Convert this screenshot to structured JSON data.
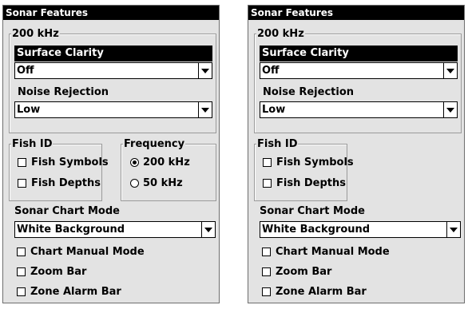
{
  "left": {
    "title": "Sonar Features",
    "group_200khz": "200 kHz",
    "surface_clarity_label": "Surface Clarity",
    "surface_clarity_value": "Off",
    "noise_rejection_label": "Noise Rejection",
    "noise_rejection_value": "Low",
    "fish_id_label": "Fish ID",
    "fish_symbols": "Fish Symbols",
    "fish_depths": "Fish Depths",
    "frequency_label": "Frequency",
    "freq_200": "200 kHz",
    "freq_50": "50 kHz",
    "chart_mode_label": "Sonar Chart Mode",
    "chart_mode_value": "White Background",
    "chart_manual_mode": "Chart Manual Mode",
    "zoom_bar": "Zoom Bar",
    "zone_alarm_bar": "Zone Alarm Bar"
  },
  "right": {
    "title": "Sonar Features",
    "group_200khz": "200 kHz",
    "surface_clarity_label": "Surface Clarity",
    "surface_clarity_value": "Off",
    "noise_rejection_label": "Noise Rejection",
    "noise_rejection_value": "Low",
    "fish_id_label": "Fish ID",
    "fish_symbols": "Fish Symbols",
    "fish_depths": "Fish Depths",
    "chart_mode_label": "Sonar Chart Mode",
    "chart_mode_value": "White Background",
    "chart_manual_mode": "Chart Manual Mode",
    "zoom_bar": "Zoom Bar",
    "zone_alarm_bar": "Zone Alarm Bar"
  },
  "icons": {
    "dropdown_arrow": "chevron-down-icon",
    "checkbox": "checkbox-icon",
    "radio": "radio-icon"
  }
}
